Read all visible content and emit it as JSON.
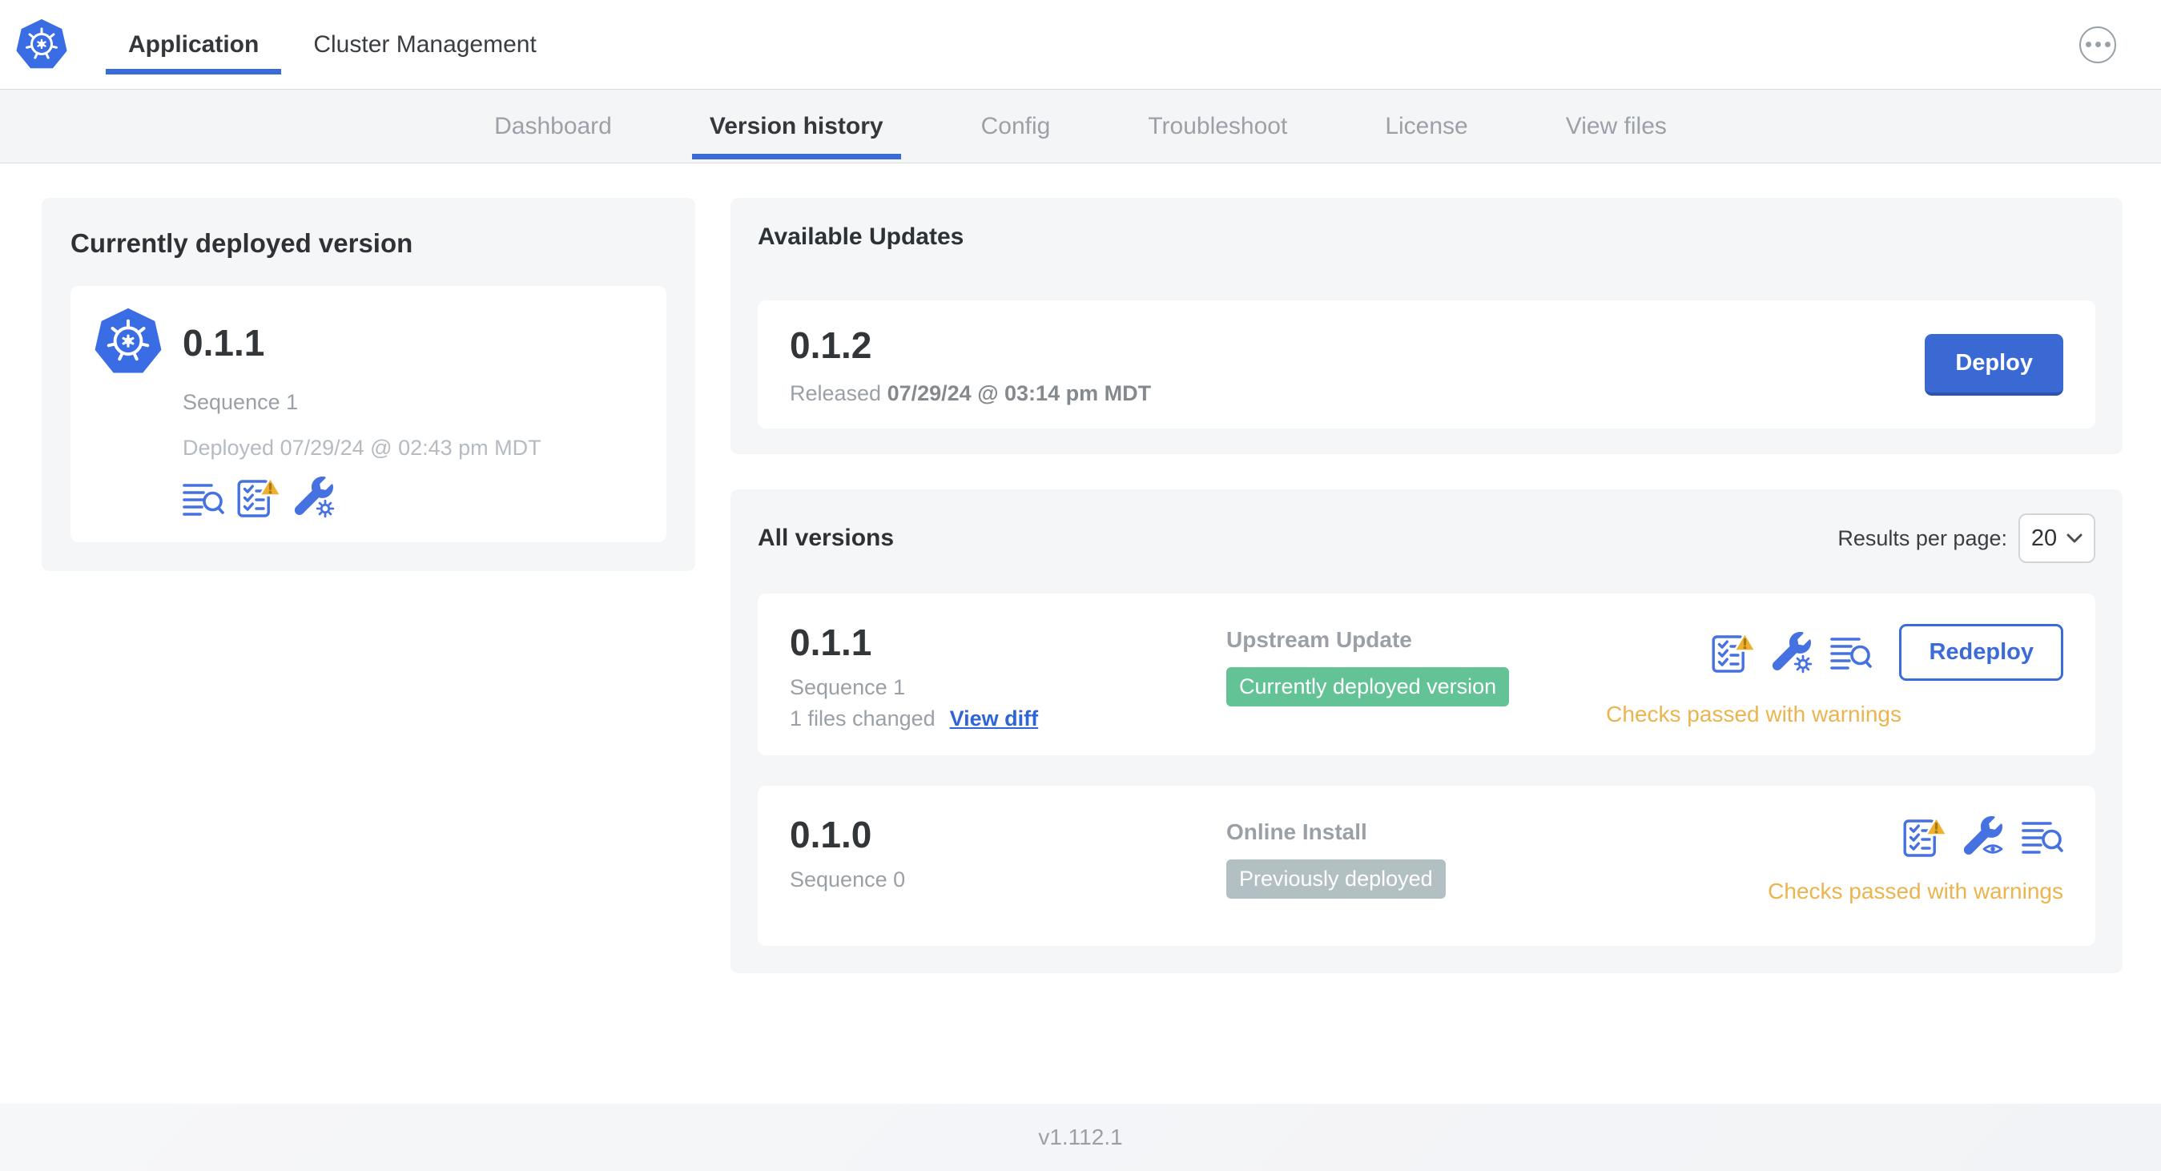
{
  "header": {
    "tabs": [
      {
        "label": "Application",
        "active": true
      },
      {
        "label": "Cluster Management",
        "active": false
      }
    ],
    "menu_icon": "ellipsis-icon",
    "logo_icon": "kubernetes-logo"
  },
  "subnav": {
    "tabs": [
      {
        "label": "Dashboard",
        "active": false
      },
      {
        "label": "Version history",
        "active": true
      },
      {
        "label": "Config",
        "active": false
      },
      {
        "label": "Troubleshoot",
        "active": false
      },
      {
        "label": "License",
        "active": false
      },
      {
        "label": "View files",
        "active": false
      }
    ]
  },
  "current_version": {
    "title": "Currently deployed version",
    "version": "0.1.1",
    "sequence": "Sequence 1",
    "deployed": "Deployed 07/29/24 @ 02:43 pm MDT",
    "icons": [
      "logs-icon",
      "preflight-checks-warning-icon",
      "edit-config-icon"
    ]
  },
  "available_updates": {
    "title": "Available Updates",
    "version": "0.1.2",
    "released_prefix": "Released",
    "released_date": "07/29/24 @ 03:14 pm MDT",
    "deploy_label": "Deploy"
  },
  "all_versions": {
    "title": "All versions",
    "results_per_page_label": "Results per page:",
    "results_per_page_value": "20",
    "rows": [
      {
        "version": "0.1.1",
        "sequence": "Sequence 1",
        "files_changed": "1 files changed",
        "view_diff_label": "View diff",
        "source": "Upstream Update",
        "badge": "Currently deployed version",
        "badge_color": "#63c396",
        "action_label": "Redeploy",
        "status": "Checks passed with warnings",
        "icons": [
          "preflight-checks-warning-icon",
          "edit-config-gear-icon",
          "logs-icon"
        ]
      },
      {
        "version": "0.1.0",
        "sequence": "Sequence 0",
        "source": "Online Install",
        "badge": "Previously deployed",
        "badge_color": "#b2bfc3",
        "status": "Checks passed with warnings",
        "icons": [
          "preflight-checks-warning-icon",
          "view-config-eye-icon",
          "logs-icon"
        ]
      }
    ]
  },
  "footer": {
    "version": "v1.112.1"
  },
  "colors": {
    "primary_blue": "#3b6bd4",
    "icon_blue": "#4671e0",
    "warning_amber": "#ecb44e",
    "warning_triangle": "#eeb02e",
    "badge_green": "#63c396",
    "badge_gray": "#b2bfc3",
    "card_bg": "#f5f6f8",
    "subnav_bg": "#f4f5f7",
    "text_dark": "#323639",
    "text_gray": "#9aa0a5",
    "text_light_gray": "#b5bbc0"
  }
}
